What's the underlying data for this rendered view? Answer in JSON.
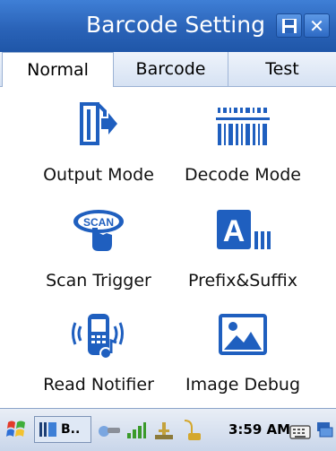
{
  "window": {
    "title": "Barcode Setting",
    "buttons": [
      {
        "icon": "save-icon"
      },
      {
        "icon": "close-icon",
        "label": "✕"
      }
    ]
  },
  "tabs": [
    {
      "label": "Normal",
      "active": true
    },
    {
      "label": "Barcode",
      "active": false
    },
    {
      "label": "Test",
      "active": false
    }
  ],
  "items": [
    {
      "label": "Output Mode",
      "icon": "output-mode-icon"
    },
    {
      "label": "Decode Mode",
      "icon": "barcode-icon"
    },
    {
      "label": "Scan Trigger",
      "icon": "scan-trigger-icon"
    },
    {
      "label": "Prefix&Suffix",
      "icon": "prefix-suffix-icon"
    },
    {
      "label": "Read Notifier",
      "icon": "read-notifier-icon"
    },
    {
      "label": "Image Debug",
      "icon": "image-icon"
    }
  ],
  "taskbar": {
    "app_label": "B..",
    "time": "3:59 AM"
  },
  "colors": {
    "accent_blue": "#1f5fbf",
    "titlebar": "#2a63b8"
  }
}
